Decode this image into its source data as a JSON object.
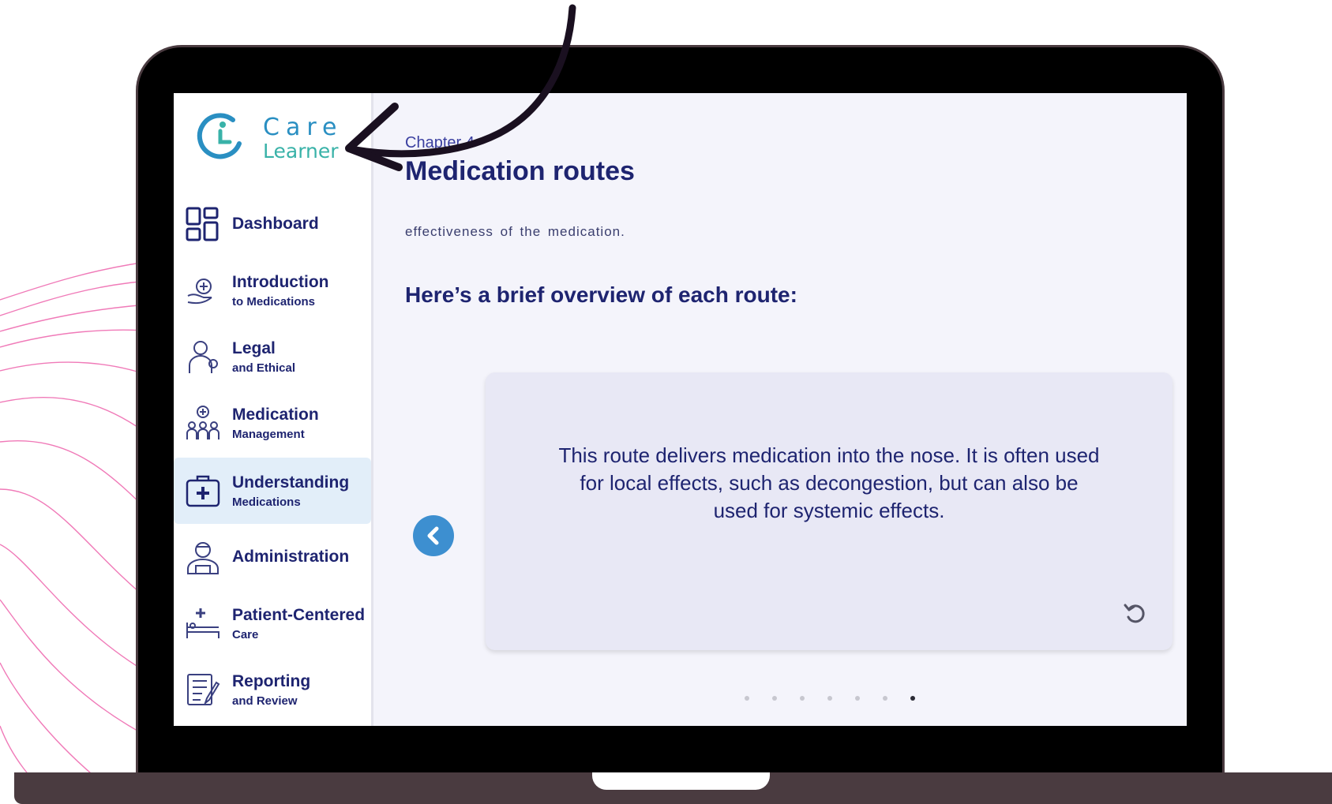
{
  "logo": {
    "care": "Care",
    "learner": "Learner"
  },
  "sidebar": {
    "items": [
      {
        "main": "Dashboard",
        "sub": "",
        "icon": "dashboard-icon"
      },
      {
        "main": "Introduction",
        "sub": "to Medications",
        "icon": "hand-medical-icon"
      },
      {
        "main": "Legal",
        "sub": "and Ethical",
        "icon": "doctor-icon"
      },
      {
        "main": "Medication",
        "sub": "Management",
        "icon": "group-medical-icon"
      },
      {
        "main": "Understanding",
        "sub": "Medications",
        "icon": "first-aid-kit-icon",
        "active": true
      },
      {
        "main": "Administration",
        "sub": "",
        "icon": "nurse-icon"
      },
      {
        "main": "Patient-Centered",
        "sub": "Care",
        "icon": "hospital-bed-icon"
      },
      {
        "main": "Reporting",
        "sub": "and Review",
        "icon": "report-icon"
      }
    ]
  },
  "content": {
    "chapter": "Chapter 4",
    "title": "Medication routes",
    "body_text": "effectiveness of the medication.",
    "subhead": "Here’s a brief overview of each route:",
    "card_text": "This route delivers medication into the nose. It is often used for local effects, such as decongestion, but can also be used for systemic effects.",
    "pagination": {
      "total": 7,
      "current": 7
    }
  },
  "colors": {
    "navy": "#1e2470",
    "accent_blue": "#3d8fd0",
    "active_bg": "#e2eef9",
    "card_bg": "#e8e8f5",
    "wave_pink": "#f07ab8",
    "frame": "#4a3b40"
  }
}
